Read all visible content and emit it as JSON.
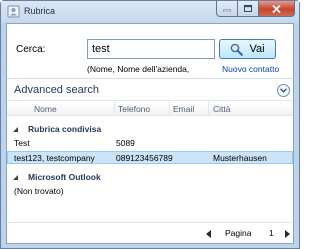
{
  "window": {
    "title": "Rubrica",
    "buttons": [
      "minimize",
      "maximize",
      "close"
    ]
  },
  "search": {
    "label": "Cerca:",
    "value": "test",
    "button_label": "Vai",
    "hint": "(Nome, Nome dell'azienda,",
    "new_contact_link": "Nuovo contatto"
  },
  "advanced": {
    "label": "Advanced search",
    "expanded": false
  },
  "table": {
    "columns": [
      "Nome",
      "Telefono",
      "Email",
      "Città"
    ],
    "groups": [
      {
        "title": "Rubrica condivisa",
        "rows": [
          {
            "nome": "Test",
            "telefono": "5089",
            "email": "",
            "citta": "",
            "selected": false
          },
          {
            "nome": "test123, testcompany",
            "telefono": "089123456789",
            "email": "",
            "citta": "Musterhausen",
            "selected": true
          }
        ]
      },
      {
        "title": "Microsoft Outlook",
        "rows": [
          {
            "nome": "(Non trovato)",
            "telefono": "",
            "email": "",
            "citta": "",
            "selected": false
          }
        ]
      }
    ]
  },
  "pager": {
    "label": "Pagina",
    "page": "1"
  },
  "colors": {
    "selection_bg": "#cce4f7",
    "link": "#0645ad",
    "group_title": "#1e395b",
    "close_button": "#c7442e"
  }
}
